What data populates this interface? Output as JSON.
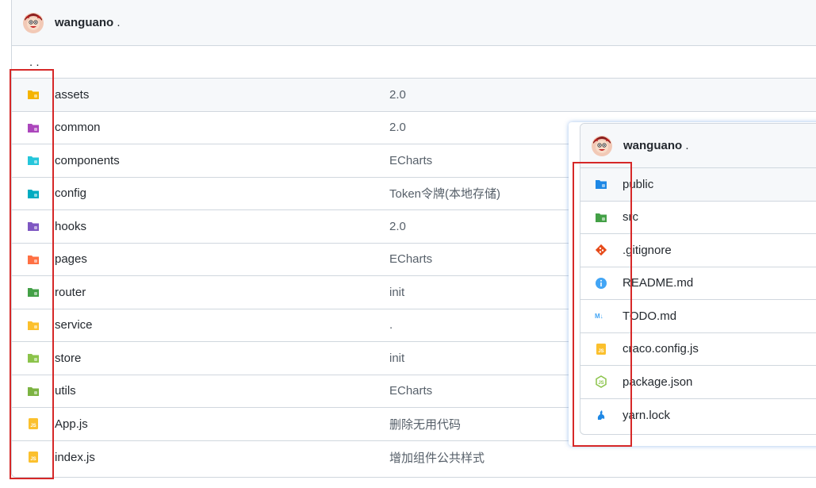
{
  "repo": {
    "owner": "wanguano",
    "owner_suffix": ".",
    "parent_link": ". .",
    "rows": [
      {
        "name": "assets",
        "message": "2.0",
        "icon": "folder-icon",
        "color": "#f4b400"
      },
      {
        "name": "common",
        "message": "2.0",
        "icon": "folder-icon",
        "color": "#ab47bc"
      },
      {
        "name": "components",
        "message": "ECharts",
        "icon": "folder-icon",
        "color": "#26c6da"
      },
      {
        "name": "config",
        "message": "Token令牌(本地存储)",
        "icon": "folder-icon",
        "color": "#00acc1"
      },
      {
        "name": "hooks",
        "message": "2.0",
        "icon": "folder-icon",
        "color": "#7e57c2"
      },
      {
        "name": "pages",
        "message": "ECharts",
        "icon": "folder-icon",
        "color": "#ff7043"
      },
      {
        "name": "router",
        "message": "init",
        "icon": "folder-icon",
        "color": "#43a047"
      },
      {
        "name": "service",
        "message": ".",
        "icon": "folder-icon",
        "color": "#fbc02d"
      },
      {
        "name": "store",
        "message": "init",
        "icon": "folder-icon",
        "color": "#8bc34a"
      },
      {
        "name": "utils",
        "message": "ECharts",
        "icon": "folder-icon",
        "color": "#7cb342"
      },
      {
        "name": "App.js",
        "message": "删除无用代码",
        "icon": "js-file-icon",
        "color": "#fbc02d"
      },
      {
        "name": "index.js",
        "message": "增加组件公共样式",
        "icon": "js-file-icon",
        "color": "#fbc02d"
      }
    ]
  },
  "overlay": {
    "owner": "wanguano",
    "owner_suffix": ".",
    "rows": [
      {
        "name": "public",
        "icon": "folder-icon",
        "color": "#1e88e5"
      },
      {
        "name": "src",
        "icon": "folder-icon",
        "color": "#43a047"
      },
      {
        "name": ".gitignore",
        "icon": "git-icon",
        "color": "#e64a19"
      },
      {
        "name": "README.md",
        "icon": "info-icon",
        "color": "#42a5f5"
      },
      {
        "name": "TODO.md",
        "icon": "markdown-icon",
        "color": "#42a5f5"
      },
      {
        "name": "craco.config.js",
        "icon": "js-file-icon",
        "color": "#fbc02d"
      },
      {
        "name": "package.json",
        "icon": "nodejs-icon",
        "color": "#8bc34a"
      },
      {
        "name": "yarn.lock",
        "icon": "yarn-icon",
        "color": "#1e88e5"
      }
    ]
  }
}
